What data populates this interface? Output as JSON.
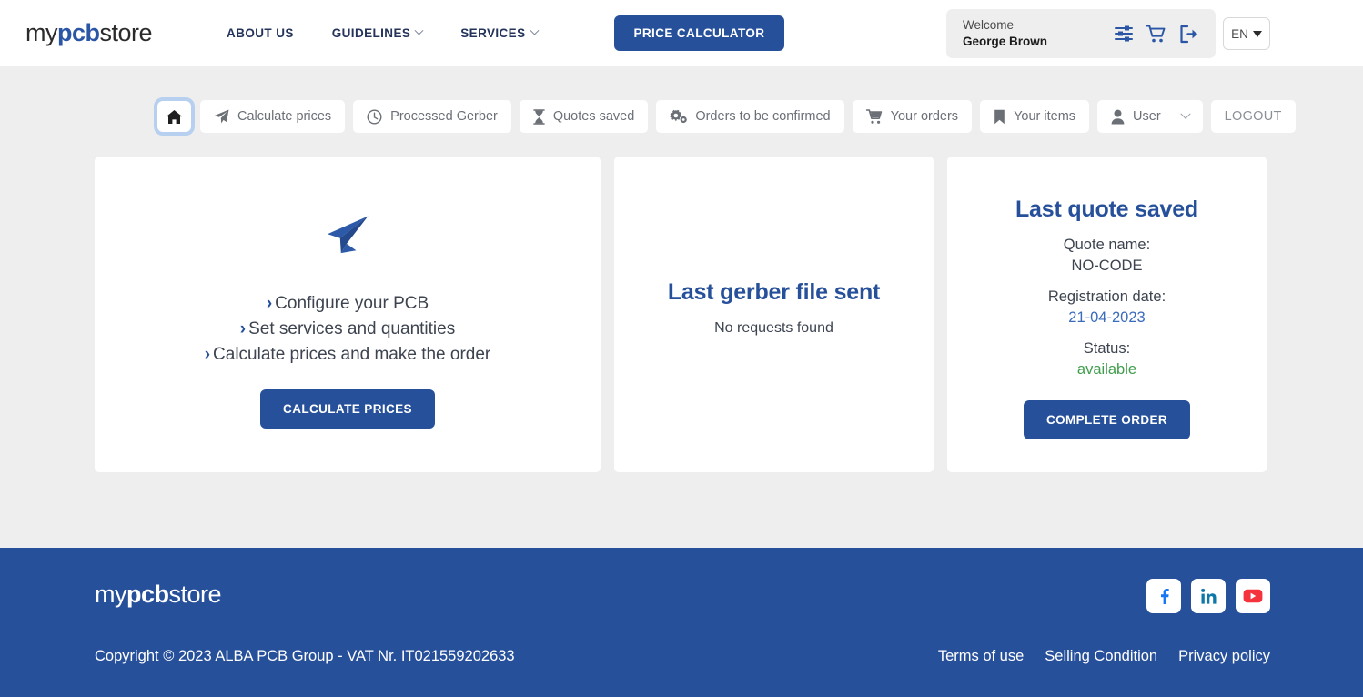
{
  "header": {
    "logo_pre": "my",
    "logo_mid": "pcb",
    "logo_post": "store",
    "nav": [
      {
        "label": "ABOUT US",
        "has_caret": false
      },
      {
        "label": "GUIDELINES",
        "has_caret": true
      },
      {
        "label": "SERVICES",
        "has_caret": true
      }
    ],
    "price_calculator": "PRICE CALCULATOR",
    "welcome_label": "Welcome",
    "user_name": "George Brown",
    "icons": [
      "settings-sliders-icon",
      "shopping-cart-icon",
      "sign-out-icon"
    ],
    "language": "EN"
  },
  "toolbar": {
    "items": [
      {
        "label": "",
        "icon": "home-icon",
        "active": true
      },
      {
        "label": "Calculate prices",
        "icon": "paper-plane-icon"
      },
      {
        "label": "Processed Gerber",
        "icon": "clock-icon"
      },
      {
        "label": "Quotes saved",
        "icon": "hourglass-icon"
      },
      {
        "label": "Orders to be confirmed",
        "icon": "gears-icon"
      },
      {
        "label": "Your orders",
        "icon": "cart-icon"
      },
      {
        "label": "Your items",
        "icon": "bookmark-icon"
      },
      {
        "label": "User",
        "icon": "person-icon",
        "has_chevron": true
      },
      {
        "label": "LOGOUT",
        "icon": "none"
      }
    ]
  },
  "cards": {
    "configure": {
      "bullets": [
        "Configure your PCB",
        "Set services and quantities",
        "Calculate prices and make the order"
      ],
      "button": "CALCULATE PRICES",
      "arrow": "›"
    },
    "gerber": {
      "title": "Last gerber file sent",
      "subtitle": "No requests found"
    },
    "quote": {
      "title": "Last quote saved",
      "name_label": "Quote name:",
      "name_value": "NO-CODE",
      "date_label": "Registration date:",
      "date_value": "21-04-2023",
      "status_label": "Status:",
      "status_value": "available",
      "button": "COMPLETE ORDER"
    }
  },
  "footer": {
    "logo_pre": "my",
    "logo_mid": "pcb",
    "logo_post": "store",
    "copyright": "Copyright © 2023 ALBA PCB Group - VAT Nr. IT021559202633",
    "social": [
      "facebook-icon",
      "linkedin-icon",
      "youtube-icon"
    ],
    "links": [
      "Terms of use",
      "Selling Condition",
      "Privacy policy"
    ]
  },
  "colors": {
    "brand_blue": "#27509b",
    "page_bg": "#eeeeee",
    "status_green": "#3f9d4b",
    "date_blue": "#3a6bbd"
  }
}
